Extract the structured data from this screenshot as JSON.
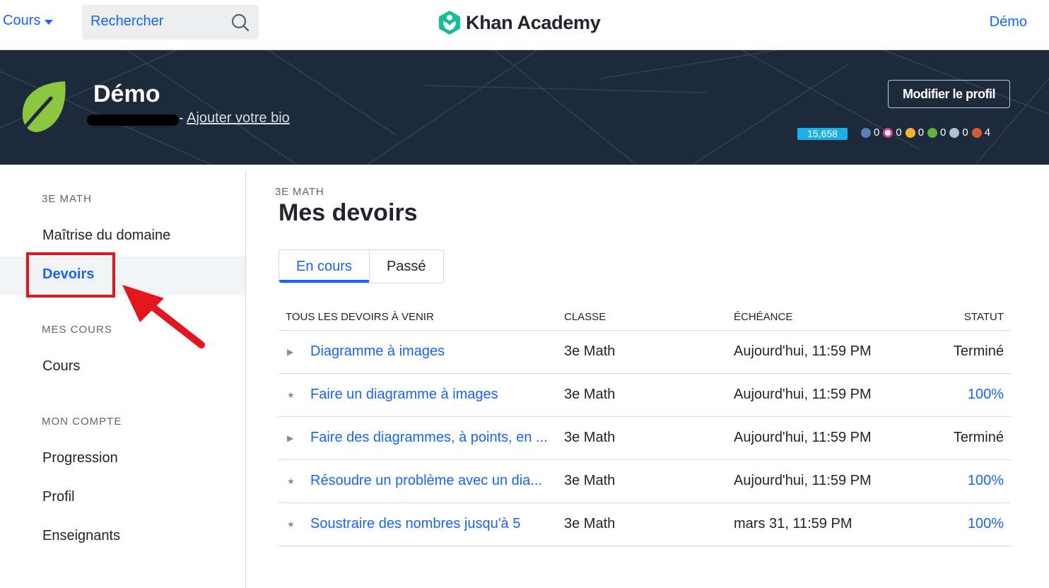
{
  "nav": {
    "courses_label": "Cours",
    "search_placeholder": "Rechercher",
    "logo_text": "Khan Academy",
    "user_label": "Démo"
  },
  "profile": {
    "name": "Démo",
    "bio_separator": "-",
    "bio_link": "Ajouter votre bio",
    "edit_button": "Modifier le profil",
    "points": "15,658",
    "badges": [
      {
        "icon": "legendary-badge-icon",
        "color": "#5b7fb8",
        "count": "0"
      },
      {
        "icon": "black-hole-badge-icon",
        "color": "#e4398f",
        "count": "0"
      },
      {
        "icon": "sun-badge-icon",
        "color": "#f5b52a",
        "count": "0"
      },
      {
        "icon": "earth-badge-icon",
        "color": "#5fb23c",
        "count": "0"
      },
      {
        "icon": "moon-badge-icon",
        "color": "#a9c3cf",
        "count": "0"
      },
      {
        "icon": "meteorite-badge-icon",
        "color": "#d95b31",
        "count": "4"
      }
    ]
  },
  "sidebar": {
    "section1": "3E MATH",
    "item_mastery": "Maîtrise du domaine",
    "item_assignments": "Devoirs",
    "section2": "MES COURS",
    "item_courses": "Cours",
    "section3": "MON COMPTE",
    "item_progress": "Progression",
    "item_profile": "Profil",
    "item_teachers": "Enseignants"
  },
  "main": {
    "subtitle": "3E MATH",
    "title": "Mes devoirs",
    "tabs": [
      "En cours",
      "Passé"
    ],
    "columns": [
      "TOUS LES DEVOIRS À VENIR",
      "CLASSE",
      "ÉCHÉANCE",
      "STATUT"
    ],
    "rows": [
      {
        "icon": "▶",
        "title": "Diagramme à images",
        "class": "3e Math",
        "due": "Aujourd'hui, 11:59 PM",
        "status": "Terminé",
        "status_type": "done"
      },
      {
        "icon": "★",
        "title": "Faire un diagramme à images",
        "class": "3e Math",
        "due": "Aujourd'hui, 11:59 PM",
        "status": "100%",
        "status_type": "pct"
      },
      {
        "icon": "▶",
        "title": "Faire des diagrammes, à points, en ...",
        "class": "3e Math",
        "due": "Aujourd'hui, 11:59 PM",
        "status": "Terminé",
        "status_type": "done"
      },
      {
        "icon": "★",
        "title": "Résoudre un problème avec un dia...",
        "class": "3e Math",
        "due": "Aujourd'hui, 11:59 PM",
        "status": "100%",
        "status_type": "pct"
      },
      {
        "icon": "★",
        "title": "Soustraire des nombres jusqu'à 5",
        "class": "3e Math",
        "due": "mars 31, 11:59 PM",
        "status": "100%",
        "status_type": "pct"
      }
    ]
  },
  "colors": {
    "accent": "#1865f2",
    "banner": "#1d2a3c",
    "annotation_red": "#e3161e",
    "logo_green": "#14bf96"
  }
}
